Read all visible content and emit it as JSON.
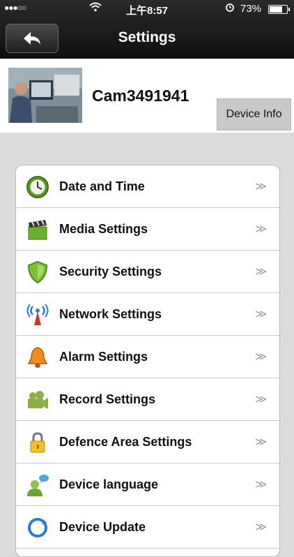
{
  "status_bar": {
    "signal": "●●●○○",
    "time": "上午8:57",
    "battery_pct": "73%",
    "battery_level": 0.73
  },
  "nav": {
    "title": "Settings"
  },
  "device": {
    "name": "Cam3491941",
    "info_button": "Device Info"
  },
  "menu": {
    "chevron": "≫",
    "items": [
      {
        "label": "Date and Time",
        "icon": "clock-icon"
      },
      {
        "label": "Media Settings",
        "icon": "clapperboard-icon"
      },
      {
        "label": "Security Settings",
        "icon": "shield-icon"
      },
      {
        "label": "Network Settings",
        "icon": "antenna-icon"
      },
      {
        "label": "Alarm Settings",
        "icon": "bell-icon"
      },
      {
        "label": "Record Settings",
        "icon": "video-camera-icon"
      },
      {
        "label": "Defence Area Settings",
        "icon": "lock-icon"
      },
      {
        "label": "Device language",
        "icon": "speech-user-icon"
      },
      {
        "label": "Device Update",
        "icon": "update-icon"
      }
    ]
  }
}
